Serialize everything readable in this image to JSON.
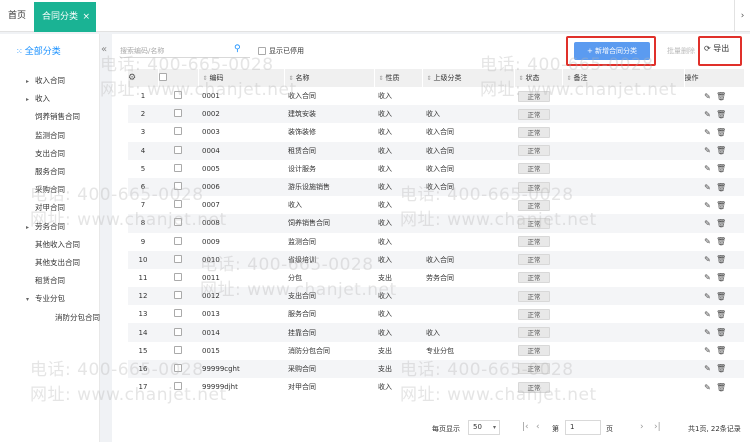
{
  "tabs": {
    "home": "首页",
    "active": "合同分类",
    "close": "×",
    "right_arrow": "›"
  },
  "sidebar": {
    "root_label": "全部分类",
    "collapse": "«",
    "items": [
      {
        "label": "收入合同",
        "caret": "▸",
        "level": 1
      },
      {
        "label": "收入",
        "caret": "▸",
        "level": 1
      },
      {
        "label": "饲养销售合同",
        "caret": "",
        "level": 1
      },
      {
        "label": "监测合同",
        "caret": "",
        "level": 1
      },
      {
        "label": "支出合同",
        "caret": "",
        "level": 1
      },
      {
        "label": "服务合同",
        "caret": "",
        "level": 1
      },
      {
        "label": "采购合同",
        "caret": "",
        "level": 1
      },
      {
        "label": "对甲合同",
        "caret": "",
        "level": 1
      },
      {
        "label": "劳务合同",
        "caret": "▸",
        "level": 1
      },
      {
        "label": "其他收入合同",
        "caret": "",
        "level": 1
      },
      {
        "label": "其他支出合同",
        "caret": "",
        "level": 1
      },
      {
        "label": "租赁合同",
        "caret": "",
        "level": 1
      },
      {
        "label": "专业分包",
        "caret": "▾",
        "level": 1
      },
      {
        "label": "消防分包合同",
        "caret": "",
        "level": 2
      }
    ]
  },
  "toolbar": {
    "search_placeholder": "搜索编码/名称",
    "show_disabled": "显示已停用",
    "add_label": "+ 新增合同分类",
    "batch_label": "批量删除",
    "export_label": "导出"
  },
  "table": {
    "headers": {
      "settings": "⚙",
      "code": "编码",
      "name": "名称",
      "nature": "性质",
      "parent": "上级分类",
      "status": "状态",
      "remark": "备注",
      "actions": "操作"
    },
    "rows": [
      {
        "no": "1",
        "code": "0001",
        "name": "收入合同",
        "nature": "收入",
        "parent": "",
        "status": "正常"
      },
      {
        "no": "2",
        "code": "0002",
        "name": "建筑安装",
        "nature": "收入",
        "parent": "收入",
        "status": "正常"
      },
      {
        "no": "3",
        "code": "0003",
        "name": "装饰装修",
        "nature": "收入",
        "parent": "收入合同",
        "status": "正常"
      },
      {
        "no": "4",
        "code": "0004",
        "name": "租赁合同",
        "nature": "收入",
        "parent": "收入合同",
        "status": "正常"
      },
      {
        "no": "5",
        "code": "0005",
        "name": "设计服务",
        "nature": "收入",
        "parent": "收入合同",
        "status": "正常"
      },
      {
        "no": "6",
        "code": "0006",
        "name": "游乐设施销售",
        "nature": "收入",
        "parent": "收入合同",
        "status": "正常"
      },
      {
        "no": "7",
        "code": "0007",
        "name": "收入",
        "nature": "收入",
        "parent": "",
        "status": "正常"
      },
      {
        "no": "8",
        "code": "0008",
        "name": "饲养销售合同",
        "nature": "收入",
        "parent": "",
        "status": "正常"
      },
      {
        "no": "9",
        "code": "0009",
        "name": "监测合同",
        "nature": "收入",
        "parent": "",
        "status": "正常"
      },
      {
        "no": "10",
        "code": "0010",
        "name": "省级培训",
        "nature": "收入",
        "parent": "收入合同",
        "status": "正常"
      },
      {
        "no": "11",
        "code": "0011",
        "name": "分包",
        "nature": "支出",
        "parent": "劳务合同",
        "status": "正常"
      },
      {
        "no": "12",
        "code": "0012",
        "name": "支出合同",
        "nature": "收入",
        "parent": "",
        "status": "正常"
      },
      {
        "no": "13",
        "code": "0013",
        "name": "服务合同",
        "nature": "收入",
        "parent": "",
        "status": "正常"
      },
      {
        "no": "14",
        "code": "0014",
        "name": "挂靠合同",
        "nature": "收入",
        "parent": "收入",
        "status": "正常"
      },
      {
        "no": "15",
        "code": "0015",
        "name": "消防分包合同",
        "nature": "支出",
        "parent": "专业分包",
        "status": "正常"
      },
      {
        "no": "16",
        "code": "99999cght",
        "name": "采购合同",
        "nature": "支出",
        "parent": "",
        "status": "正常"
      },
      {
        "no": "17",
        "code": "99999djht",
        "name": "对甲合同",
        "nature": "收入",
        "parent": "",
        "status": "正常"
      }
    ]
  },
  "pager": {
    "per_label": "每页显示",
    "per_value": "50",
    "first": "|‹",
    "prev": "‹",
    "page_prefix": "第",
    "page_value": "1",
    "page_unit": "页",
    "next": "›",
    "last": "›|",
    "total": "共1页, 22条记录"
  },
  "watermark": {
    "phone": "电话: 400-665-0028",
    "site": "网址: www.chanjet.net"
  }
}
